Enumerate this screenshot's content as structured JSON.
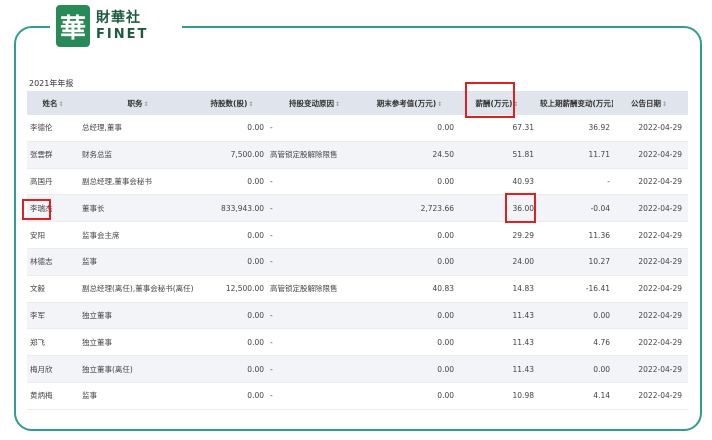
{
  "logo": {
    "seal": "華",
    "name_cn": "財華社",
    "name_en": "FINET"
  },
  "caption": "2021年年报",
  "table": {
    "headers": [
      "姓名",
      "职务",
      "持股数(股)",
      "持股变动原因",
      "期末参考值(万元)",
      "薪酬(万元)",
      "较上期薪酬变动(万元)",
      "公告日期"
    ],
    "sort_glyph": "↕",
    "rows": [
      [
        "李德伦",
        "总经理,董事",
        "0.00",
        "-",
        "0.00",
        "67.31",
        "36.92",
        "2022-04-29"
      ],
      [
        "张雲群",
        "财务总监",
        "7,500.00",
        "高管锁定股解除限售",
        "24.50",
        "51.81",
        "11.71",
        "2022-04-29"
      ],
      [
        "高国丹",
        "副总经理,董事会秘书",
        "0.00",
        "-",
        "0.00",
        "40.93",
        "-",
        "2022-04-29"
      ],
      [
        "李瑞杰",
        "董事长",
        "833,943.00",
        "-",
        "2,723.66",
        "36.00",
        "-0.04",
        "2022-04-29"
      ],
      [
        "安阳",
        "监事会主席",
        "0.00",
        "-",
        "0.00",
        "29.29",
        "11.36",
        "2022-04-29"
      ],
      [
        "林德志",
        "监事",
        "0.00",
        "-",
        "0.00",
        "24.00",
        "10.27",
        "2022-04-29"
      ],
      [
        "文毅",
        "副总经理(离任),董事会秘书(离任)",
        "12,500.00",
        "高管锁定股解除限售",
        "40.83",
        "14.83",
        "-16.41",
        "2022-04-29"
      ],
      [
        "李军",
        "独立董事",
        "0.00",
        "-",
        "0.00",
        "11.43",
        "0.00",
        "2022-04-29"
      ],
      [
        "郑飞",
        "独立董事",
        "0.00",
        "-",
        "0.00",
        "11.43",
        "4.76",
        "2022-04-29"
      ],
      [
        "梅月欣",
        "独立董事(离任)",
        "0.00",
        "-",
        "0.00",
        "11.43",
        "0.00",
        "2022-04-29"
      ],
      [
        "黄炳梅",
        "监事",
        "0.00",
        "-",
        "0.00",
        "10.98",
        "4.14",
        "2022-04-29"
      ]
    ]
  },
  "colors": {
    "frame": "#2f9e8c",
    "highlight": "#e02020",
    "header_bg": "#e0e4ec"
  }
}
